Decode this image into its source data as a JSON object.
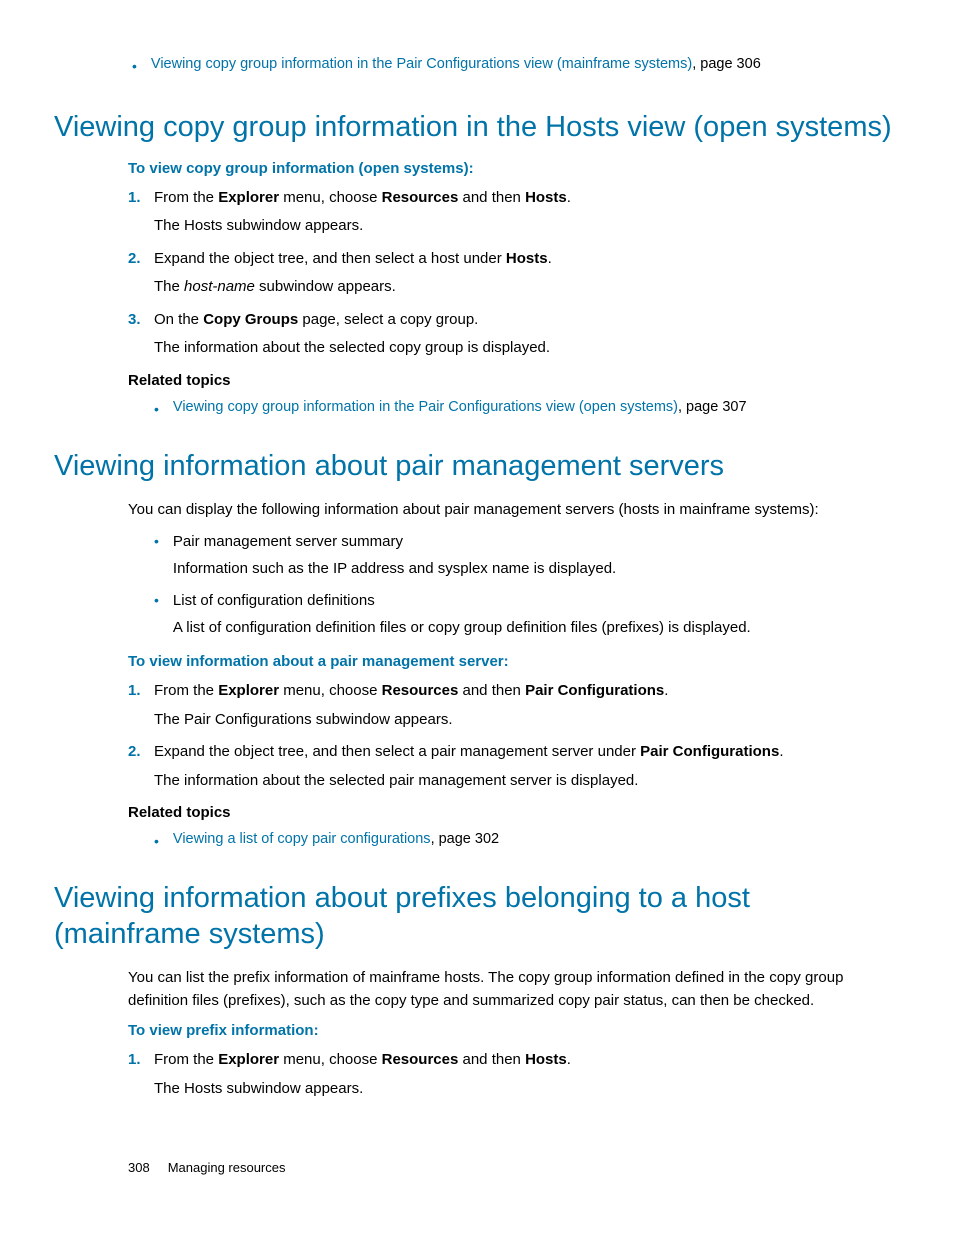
{
  "topRelated": {
    "link": "Viewing copy group information in the Pair Configurations view (mainframe systems)",
    "suffix": ", page 306"
  },
  "section1": {
    "heading": "Viewing copy group information in the Hosts view (open systems)",
    "procTitle": "To view copy group information (open systems):",
    "steps": [
      {
        "n": "1.",
        "pre": "From the ",
        "b1": "Explorer",
        "mid1": " menu, choose ",
        "b2": "Resources",
        "mid2": " and then ",
        "b3": "Hosts",
        "post": ".",
        "sub": "The Hosts subwindow appears."
      },
      {
        "n": "2.",
        "pre": "Expand the object tree, and then select a host under ",
        "b1": "Hosts",
        "post": ".",
        "subPre": "The ",
        "subIt": "host-name",
        "subPost": " subwindow appears."
      },
      {
        "n": "3.",
        "pre": "On the ",
        "b1": "Copy Groups",
        "post": " page, select a copy group.",
        "sub": "The information about the selected copy group is displayed."
      }
    ],
    "relatedHeading": "Related topics",
    "related": {
      "link": "Viewing copy group information in the Pair Configurations view (open systems)",
      "suffix": ", page 307"
    }
  },
  "section2": {
    "heading": "Viewing information about pair management servers",
    "intro": "You can display the following information about pair management servers (hosts in mainframe systems):",
    "bullets": [
      {
        "title": "Pair management server summary",
        "desc": "Information such as the IP address and sysplex name is displayed."
      },
      {
        "title": "List of configuration definitions",
        "desc": "A list of configuration definition files or copy group definition files (prefixes) is displayed."
      }
    ],
    "procTitle": "To view information about a pair management server:",
    "steps": [
      {
        "n": "1.",
        "pre": "From the ",
        "b1": "Explorer",
        "mid1": " menu, choose ",
        "b2": "Resources",
        "mid2": " and then ",
        "b3": "Pair Configurations",
        "post": ".",
        "sub": "The Pair Configurations subwindow appears."
      },
      {
        "n": "2.",
        "pre": "Expand the object tree, and then select a pair management server under ",
        "b1": "Pair Configurations",
        "post": ".",
        "sub": "The information about the selected pair management server is displayed."
      }
    ],
    "relatedHeading": "Related topics",
    "related": {
      "link": "Viewing a list of copy pair configurations",
      "suffix": ", page 302"
    }
  },
  "section3": {
    "heading": "Viewing information about prefixes belonging to a host (mainframe systems)",
    "intro": "You can list the prefix information of mainframe hosts. The copy group information defined in the copy group definition files (prefixes), such as the copy type and summarized copy pair status, can then be checked.",
    "procTitle": "To view prefix information:",
    "steps": [
      {
        "n": "1.",
        "pre": "From the ",
        "b1": "Explorer",
        "mid1": " menu, choose ",
        "b2": "Resources",
        "mid2": " and then ",
        "b3": "Hosts",
        "post": ".",
        "sub": "The Hosts subwindow appears."
      }
    ]
  },
  "footer": {
    "page": "308",
    "title": "Managing resources"
  }
}
